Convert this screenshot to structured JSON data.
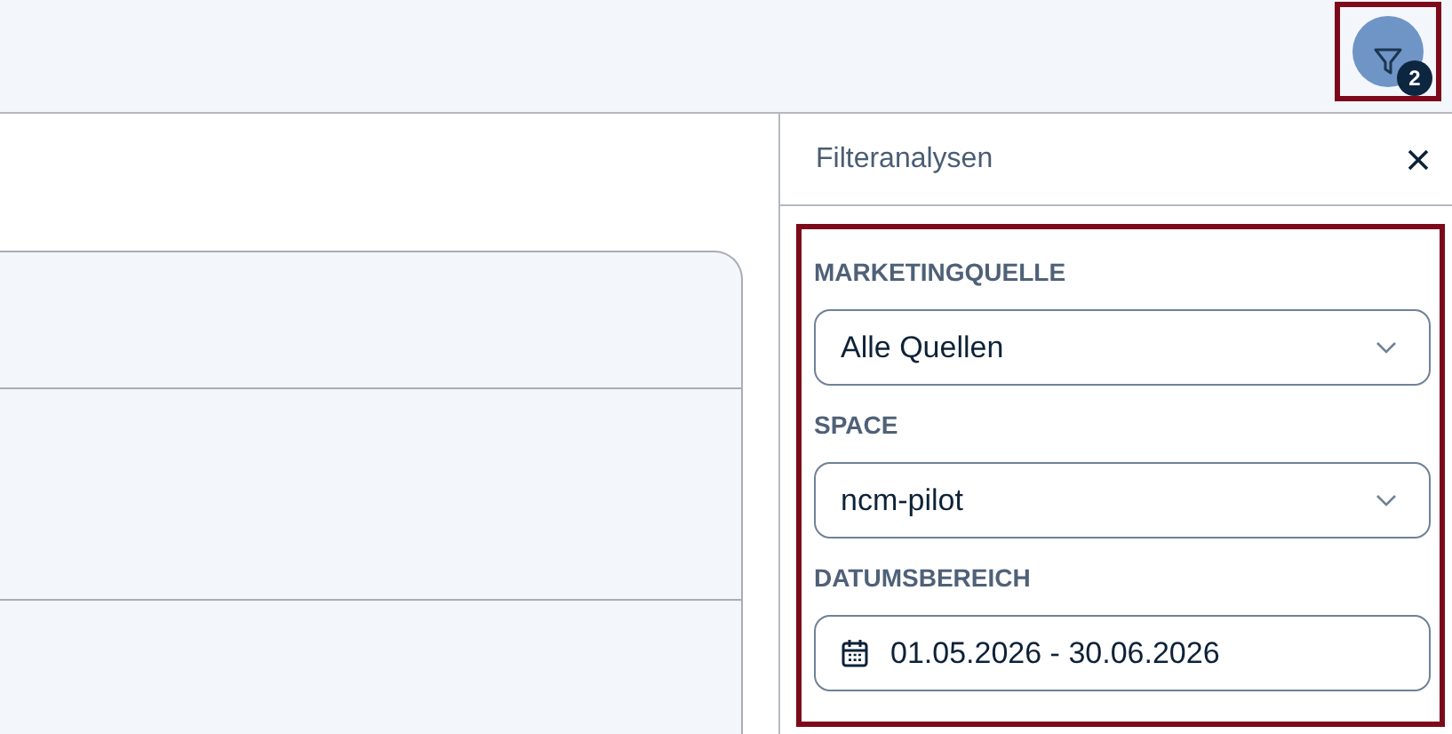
{
  "filter_button": {
    "badge": "2"
  },
  "panel": {
    "title": "Filteranalysen",
    "filters": [
      {
        "kind": "select",
        "label": "MARKETINGQUELLE",
        "value": "Alle Quellen"
      },
      {
        "kind": "select",
        "label": "SPACE",
        "value": "ncm-pilot"
      },
      {
        "kind": "date",
        "label": "DATUMSBEREICH",
        "value": "01.05.2026 - 30.06.2026"
      }
    ]
  }
}
